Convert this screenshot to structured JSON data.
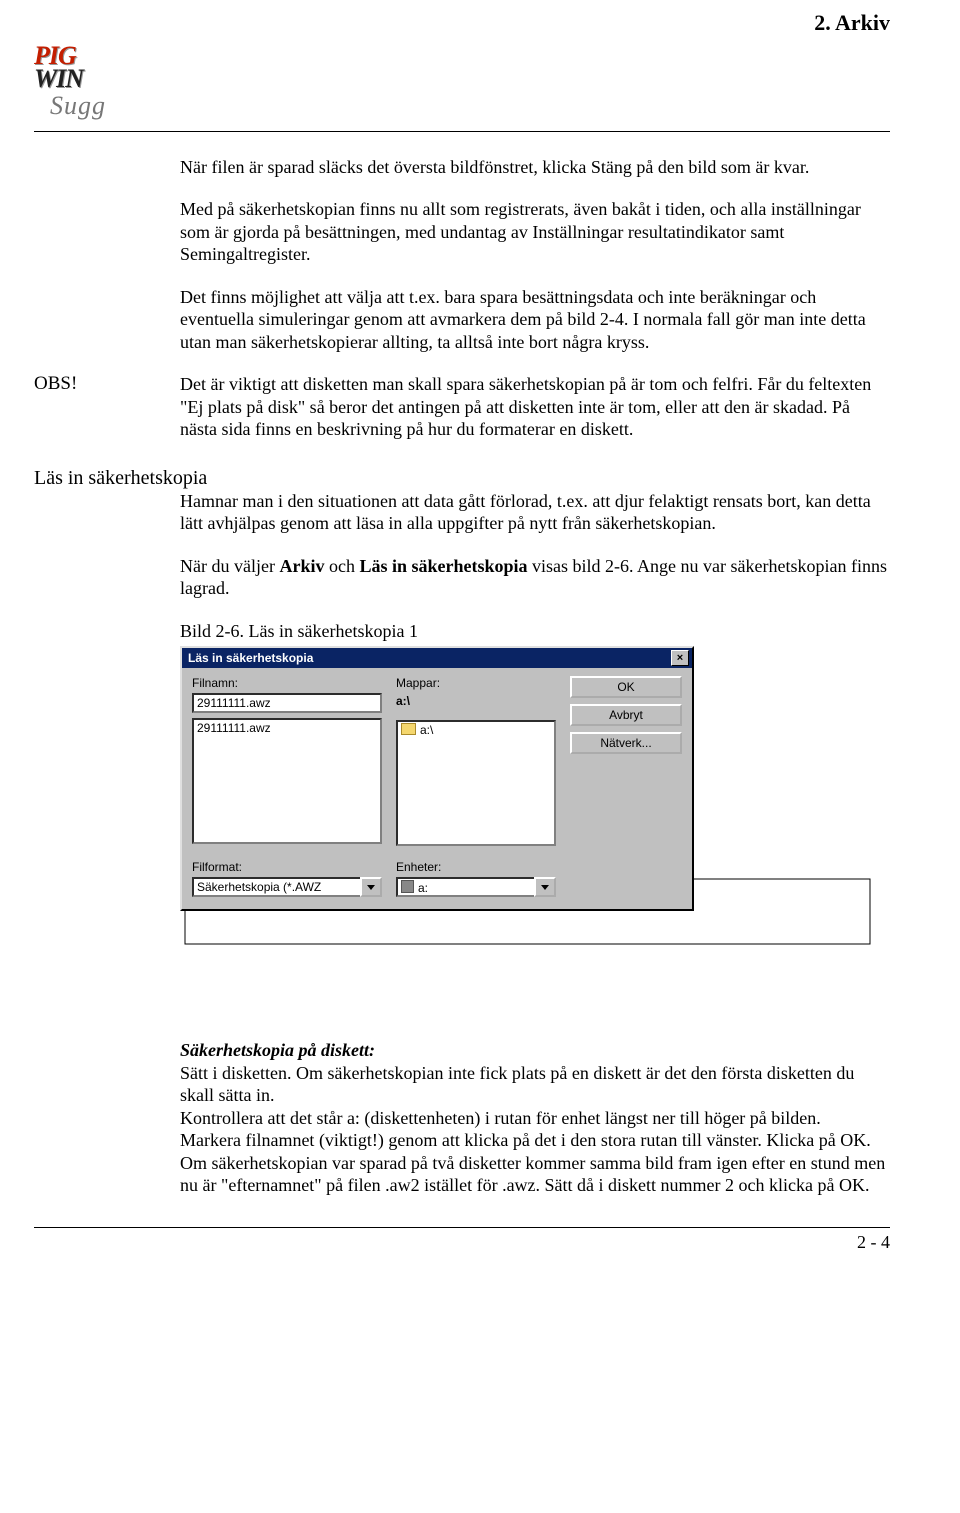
{
  "header": {
    "section_title": "2. Arkiv",
    "logo_pig": "PIG",
    "logo_win": "WIN",
    "logo_sub": "Sugg"
  },
  "body": {
    "p1": "När filen är sparad släcks det översta bildfönstret, klicka Stäng på den bild som är kvar.",
    "p2": "Med på säkerhetskopian finns nu allt som registrerats, även bakåt i tiden, och alla inställningar som är gjorda på besättningen, med undantag av Inställningar resultatindikator samt Semingaltregister.",
    "p3": "Det finns möjlighet att välja att t.ex. bara spara besättningsdata och inte beräkningar och eventuella simuleringar genom att avmarkera dem på bild 2-4. I normala fall gör man inte detta utan man säkerhetskopierar allting, ta alltså inte bort några kryss.",
    "obs_label": "OBS!",
    "obs_text": "Det är viktigt att disketten man skall spara säkerhetskopian på är tom och felfri. Får du feltexten \"Ej plats på disk\" så beror det antingen på att disketten inte är tom, eller att den är skadad. På nästa sida finns en beskrivning på hur du formaterar en diskett."
  },
  "lasin": {
    "heading": "Läs in säkerhetskopia",
    "p1": "Hamnar man i den situationen att data gått förlorad, t.ex. att djur felaktigt rensats bort, kan detta lätt avhjälpas genom att läsa in alla uppgifter på nytt från säkerhetskopian.",
    "p2_pre": "När du väljer ",
    "p2_b1": "Arkiv",
    "p2_mid": " och ",
    "p2_b2": "Läs in säkerhetskopia",
    "p2_post": " visas bild 2-6. Ange nu var säkerhetskopian finns lagrad.",
    "fig_caption": "Bild 2-6. Läs in säkerhetskopia 1"
  },
  "dialog": {
    "title": "Läs in säkerhetskopia",
    "filnamn_label": "Filnamn:",
    "filnamn_value": "29111111.awz",
    "list_item": "29111111.awz",
    "mappar_label": "Mappar:",
    "mappar_value": "a:\\",
    "folder_item": "a:\\",
    "filformat_label": "Filformat:",
    "filformat_value": "Säkerhetskopia (*.AWZ",
    "enheter_label": "Enheter:",
    "enheter_value": "a:",
    "ok": "OK",
    "avbryt": "Avbryt",
    "natverk": "Nätverk..."
  },
  "instructions": {
    "title": "Säkerhetskopia på diskett:",
    "l1": "Sätt i disketten. Om säkerhetskopian inte fick plats på en diskett är det den första disketten du skall sätta in.",
    "l2": "Kontrollera att det står a: (diskettenheten) i rutan för enhet längst ner till höger på bilden.",
    "l3": "Markera filnamnet (viktigt!) genom att klicka på det i den stora rutan till vänster. Klicka på OK.",
    "l4": "Om säkerhetskopian var sparad på två disketter kommer samma bild fram igen efter en stund men nu är \"efternamnet\" på filen .aw2 istället för .awz. Sätt då i diskett nummer 2 och klicka på OK."
  },
  "footer": {
    "page": "2 - 4"
  }
}
